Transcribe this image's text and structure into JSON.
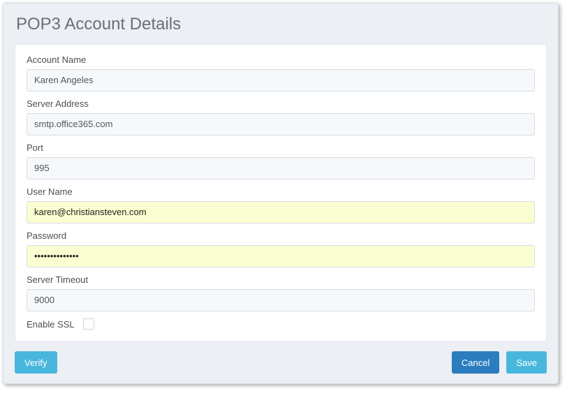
{
  "dialog": {
    "title": "POP3 Account Details"
  },
  "form": {
    "account_name": {
      "label": "Account Name",
      "value": "Karen Angeles"
    },
    "server_address": {
      "label": "Server Address",
      "value": "smtp.office365.com"
    },
    "port": {
      "label": "Port",
      "value": "995"
    },
    "user_name": {
      "label": "User Name",
      "value": "karen@christiansteven.com"
    },
    "password": {
      "label": "Password",
      "value": "••••••••••••••"
    },
    "server_timeout": {
      "label": "Server Timeout",
      "value": "9000"
    },
    "enable_ssl": {
      "label": "Enable SSL",
      "checked": false
    }
  },
  "buttons": {
    "verify": "Verify",
    "cancel": "Cancel",
    "save": "Save"
  }
}
